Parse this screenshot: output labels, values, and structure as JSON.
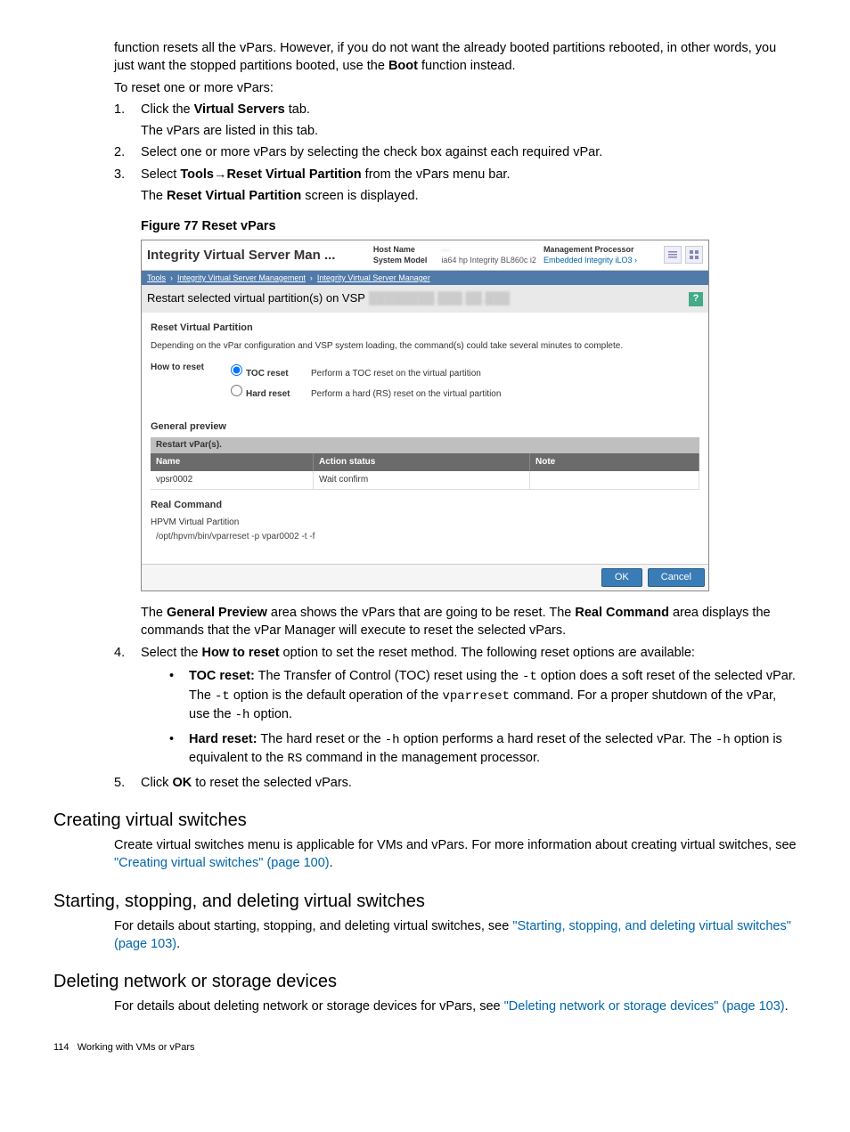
{
  "intro": {
    "p1_a": "function resets all the vPars. However, if you do not want the already booted partitions rebooted, in other words, you just want the stopped partitions booted, use the ",
    "p1_bold": "Boot",
    "p1_b": " function instead.",
    "p2": "To reset one or more vPars:"
  },
  "steps": {
    "s1_a": "Click the ",
    "s1_bold": "Virtual Servers",
    "s1_b": " tab.",
    "s1_sub": "The vPars are listed in this tab.",
    "s2": "Select one or more vPars by selecting the check box against each required vPar.",
    "s3_a": "Select ",
    "s3_bold1": "Tools",
    "s3_arrow": "→",
    "s3_bold2": "Reset Virtual Partition",
    "s3_b": " from the vPars menu bar.",
    "s3_sub_a": "The ",
    "s3_sub_bold": "Reset Virtual Partition",
    "s3_sub_b": " screen is displayed."
  },
  "figure": {
    "caption": "Figure 77 Reset vPars",
    "title": "Integrity Virtual Server Man ...",
    "host_name_label": "Host Name",
    "host_name_value": "—",
    "system_model_label": "System Model",
    "system_model_value": "ia64 hp Integrity BL860c i2",
    "mp_label": "Management Processor",
    "mp_value": "Embedded Integrity iLO3 ›",
    "breadcrumb_tools": "Tools",
    "breadcrumb_a": "Integrity Virtual Server Management",
    "breadcrumb_b": "Integrity Virtual Server Manager",
    "subtitle": "Restart selected virtual partition(s) on VSP",
    "section1": "Reset Virtual Partition",
    "desc": "Depending on the vPar configuration and VSP system loading, the command(s) could take several minutes to complete.",
    "howto": "How to reset",
    "opt1": "TOC reset",
    "opt1_desc": "Perform a TOC reset on the virtual partition",
    "opt2": "Hard reset",
    "opt2_desc": "Perform a hard (RS) reset on the virtual partition",
    "general_preview": "General preview",
    "restart_bar": "Restart vPar(s).",
    "th_name": "Name",
    "th_action": "Action status",
    "th_note": "Note",
    "row_name": "vpsr0002",
    "row_action": "Wait confirm",
    "real_command": "Real Command",
    "hpvm": "HPVM Virtual Partition",
    "cmd": "/opt/hpvm/bin/vparreset -p vpar0002 -t -f",
    "ok": "OK",
    "cancel": "Cancel"
  },
  "after_figure": {
    "p_a": "The ",
    "p_bold1": "General Preview",
    "p_b": " area shows the vPars that are going to be reset. The ",
    "p_bold2": "Real Command",
    "p_c": " area displays the commands that the vPar Manager will execute to reset the selected vPars."
  },
  "step4": {
    "main_a": "Select the ",
    "main_bold": "How to reset",
    "main_b": " option to set the reset method. The following reset options are available:",
    "b1_bold": "TOC reset:",
    "b1_a": " The Transfer of Control (TOC) reset using the ",
    "b1_code1": "-t",
    "b1_b": " option does a soft reset of the selected vPar. The ",
    "b1_code2": "-t",
    "b1_c": " option is the default operation of the ",
    "b1_code3": "vparreset",
    "b1_d": " command. For a proper shutdown of the vPar, use the ",
    "b1_code4": "-h",
    "b1_e": " option.",
    "b2_bold": "Hard reset:",
    "b2_a": " The hard reset or the ",
    "b2_code1": "-h",
    "b2_b": " option performs a hard reset of the selected vPar. The ",
    "b2_code2": "-h",
    "b2_c": " option is equivalent to the ",
    "b2_code3": "RS",
    "b2_d": " command in the management processor."
  },
  "step5_a": "Click ",
  "step5_bold": "OK",
  "step5_b": " to reset the selected vPars.",
  "sections": {
    "vswitches_title": "Creating virtual switches",
    "vswitches_a": "Create virtual switches menu is applicable for VMs and vPars. For more information about creating virtual switches, see ",
    "vswitches_link": "\"Creating virtual switches\" (page 100)",
    "vswitches_b": ".",
    "ssdel_title": "Starting, stopping, and deleting virtual switches",
    "ssdel_a": "For details about starting, stopping, and deleting virtual switches, see ",
    "ssdel_link": "\"Starting, stopping, and deleting virtual switches\" (page 103)",
    "ssdel_b": ".",
    "delnet_title": "Deleting network or storage devices",
    "delnet_a": "For details about deleting network or storage devices for vPars, see ",
    "delnet_link": "\"Deleting network or storage devices\" (page 103)",
    "delnet_b": "."
  },
  "footer": {
    "page": "114",
    "chapter": "Working with VMs or vPars"
  }
}
